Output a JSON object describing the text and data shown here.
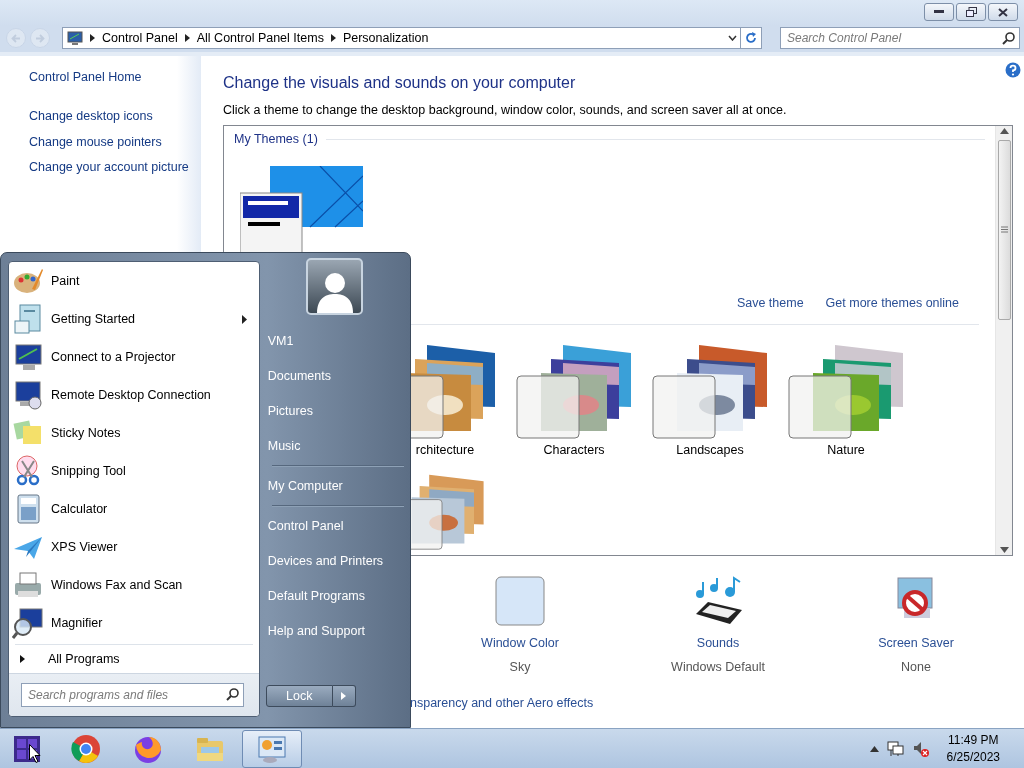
{
  "history_buttons": [
    {
      "disabled": true
    },
    {
      "disabled": true
    }
  ],
  "address_bar": {
    "breadcrumbs": [
      "Control Panel",
      "All Control Panel Items",
      "Personalization"
    ]
  },
  "search": {
    "placeholder": "Search Control Panel"
  },
  "sidebar": {
    "items": [
      "Control Panel Home",
      "Change desktop icons",
      "Change mouse pointers",
      "Change your account picture"
    ]
  },
  "heading": "Change the visuals and sounds on your computer",
  "description": "Click a theme to change the desktop background, window color, sounds, and screen saver all at once.",
  "themes": {
    "group_title": "My Themes (1)",
    "links": [
      "Save theme",
      "Get more themes online"
    ],
    "items": [
      {
        "label": "rchitecture"
      },
      {
        "label": "Characters"
      },
      {
        "label": "Landscapes"
      },
      {
        "label": "Nature"
      }
    ]
  },
  "settings": [
    {
      "label": "Window Color",
      "value": "Sky"
    },
    {
      "label": "Sounds",
      "value": "Windows Default"
    },
    {
      "label": "Screen Saver",
      "value": "None"
    }
  ],
  "aero_link": "nsparency and other Aero effects",
  "start_menu": {
    "programs": [
      {
        "label": "Paint",
        "submenu": false
      },
      {
        "label": "Getting Started",
        "submenu": true
      },
      {
        "label": "Connect to a Projector",
        "submenu": false
      },
      {
        "label": "Remote Desktop Connection",
        "submenu": false
      },
      {
        "label": "Sticky Notes",
        "submenu": false
      },
      {
        "label": "Snipping Tool",
        "submenu": false
      },
      {
        "label": "Calculator",
        "submenu": false
      },
      {
        "label": "XPS Viewer",
        "submenu": false
      },
      {
        "label": "Windows Fax and Scan",
        "submenu": false
      },
      {
        "label": "Magnifier",
        "submenu": false
      }
    ],
    "all_programs": "All Programs",
    "search_placeholder": "Search programs and files",
    "places": [
      [
        "VM1",
        "Documents",
        "Pictures",
        "Music"
      ],
      [
        "My Computer"
      ],
      [
        "Control Panel",
        "Devices and Printers",
        "Default Programs",
        "Help and Support"
      ]
    ],
    "lock_button": "Lock"
  },
  "taskbar": {
    "apps": [
      {
        "selected": false
      },
      {
        "selected": false
      },
      {
        "selected": false
      },
      {
        "selected": true
      }
    ],
    "time": "11:49 PM",
    "date": "6/25/2023"
  }
}
